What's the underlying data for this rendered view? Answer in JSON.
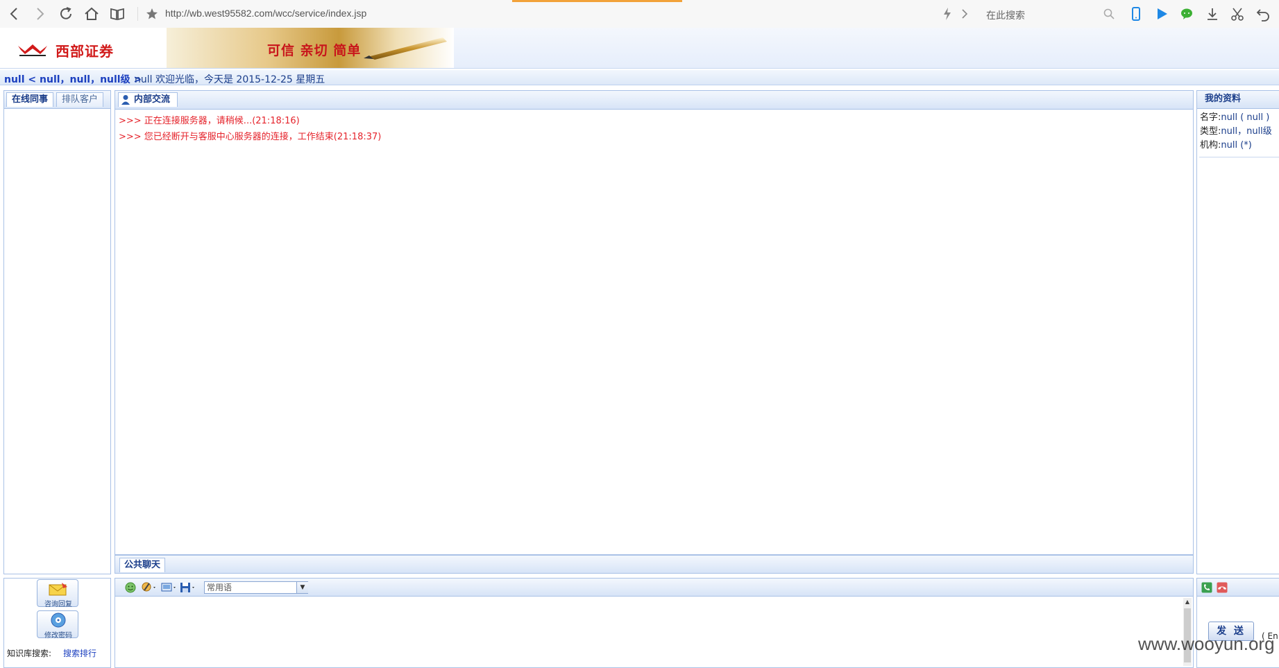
{
  "browser": {
    "url": "http://wb.west95582.com/wcc/service/index.jsp",
    "search_placeholder": "在此搜索"
  },
  "header": {
    "logo_text": "西部证券",
    "slogan": "可信 亲切 简单"
  },
  "status": {
    "user_info": "null < null，null，null级 >",
    "welcome": "null 欢迎光临，今天是 2015-12-25 星期五"
  },
  "left_panel": {
    "tabs": [
      {
        "label": "在线同事",
        "active": true
      },
      {
        "label": "排队客户",
        "active": false
      }
    ]
  },
  "center_panel": {
    "tab_label": "内部交流",
    "messages": [
      ">>> 正在连接服务器，请稍候...(21:18:16)",
      ">>> 您已经断开与客服中心服务器的连接，工作结束(21:18:37)"
    ],
    "public_chat_tab": "公共聊天"
  },
  "right_panel": {
    "tab_label": "我的资料",
    "profile": [
      {
        "key": "名字:",
        "value": "null ( null )"
      },
      {
        "key": "类型:",
        "value": "null，null级"
      },
      {
        "key": "机构:",
        "value": "null (*)"
      }
    ]
  },
  "tools": {
    "consult_reply": "咨询回复",
    "change_password": "修改密码",
    "kb_search_label": "知识库搜索:",
    "search_ranking": "搜索排行"
  },
  "input": {
    "phrase_select": "常用语",
    "send_label": "发 送",
    "enter_hint": "( En"
  },
  "watermark": "www.wooyun.org",
  "colors": {
    "accent": "#1a3d8a",
    "message_red": "#e5232b",
    "brand_red": "#d11a1a",
    "panel_border": "#a9c1e6"
  }
}
